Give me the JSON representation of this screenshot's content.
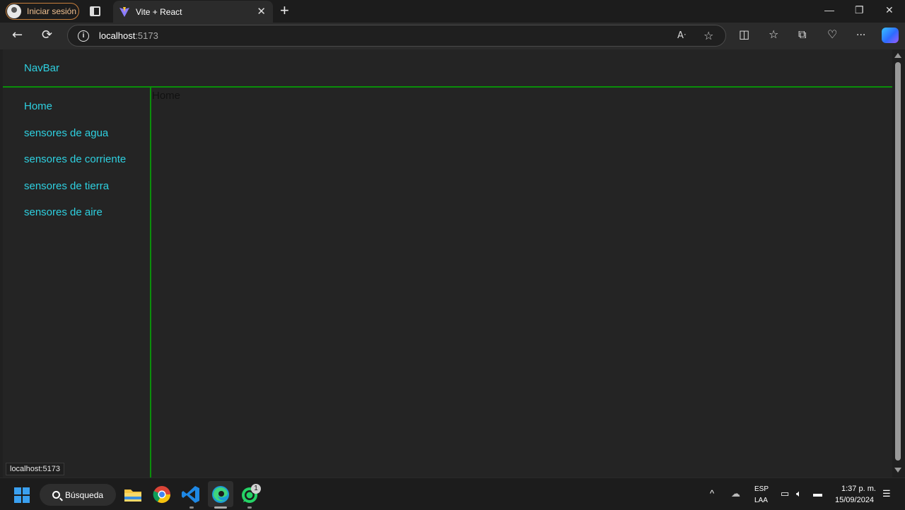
{
  "browser": {
    "profile_label": "Iniciar sesión",
    "tab_title": "Vite + React",
    "tab_close": "✕",
    "new_tab": "+",
    "url_host": "localhost",
    "url_port": ":5173",
    "window_controls": {
      "minimize": "—",
      "restore": "❐",
      "close": "✕"
    },
    "nav": {
      "back": "←",
      "refresh": "⟳",
      "more": "···"
    }
  },
  "page": {
    "navbar_title": "NavBar",
    "sidebar": [
      {
        "label": "Home"
      },
      {
        "label": "sensores de agua"
      },
      {
        "label": "sensores de corriente"
      },
      {
        "label": "sensores de tierra"
      },
      {
        "label": "sensores de aire"
      }
    ],
    "main_text": "Home",
    "status_url": "localhost:5173"
  },
  "colors": {
    "link": "#2ed0e0",
    "border_accent": "#0a8f0a",
    "background": "#242424"
  },
  "taskbar": {
    "search_label": "Búsqueda",
    "whatsapp_badge": "1",
    "language_top": "ESP",
    "language_bottom": "LAA",
    "time": "1:37 p. m.",
    "date": "15/09/2024"
  }
}
